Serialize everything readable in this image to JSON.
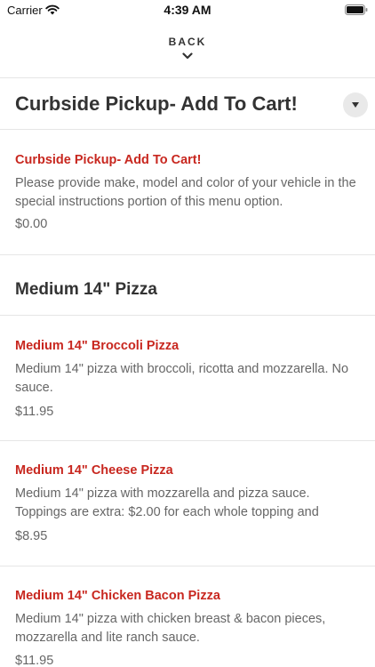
{
  "status_bar": {
    "carrier": "Carrier",
    "time": "4:39 AM"
  },
  "nav": {
    "back_label": "BACK"
  },
  "sections": [
    {
      "title": "Curbside Pickup- Add To Cart!",
      "items": [
        {
          "name": "Curbside Pickup- Add To Cart!",
          "description": "Please provide make, model and color of your vehicle in the special instructions portion of this menu option.",
          "price": "$0.00"
        }
      ]
    },
    {
      "title": "Medium 14\" Pizza",
      "items": [
        {
          "name": "Medium 14\" Broccoli Pizza",
          "description": "Medium 14\" pizza with broccoli, ricotta and mozzarella. No sauce.",
          "price": "$11.95"
        },
        {
          "name": "Medium 14\" Cheese Pizza",
          "description": "Medium 14\" pizza with mozzarella and pizza sauce. Toppings are extra: $2.00 for each whole topping and",
          "price": "$8.95"
        },
        {
          "name": "Medium 14\" Chicken Bacon Pizza",
          "description": "Medium 14\" pizza with chicken breast & bacon pieces, mozzarella and lite ranch sauce.",
          "price": "$11.95"
        }
      ]
    }
  ],
  "colors": {
    "item_name": "#c8271f",
    "text": "#333333",
    "muted": "#666666",
    "divider": "#e6e6e6"
  }
}
